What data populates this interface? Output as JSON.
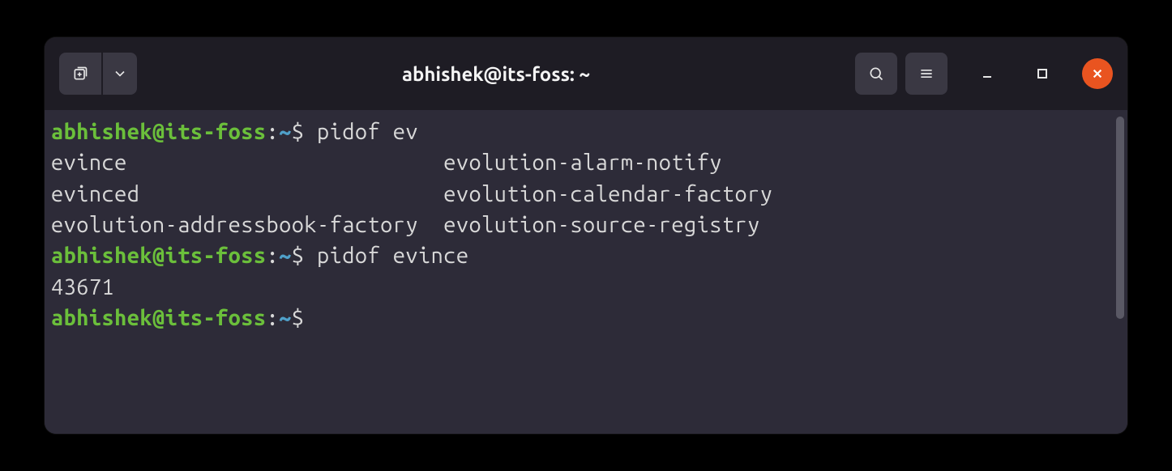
{
  "window": {
    "title": "abhishek@its-foss: ~"
  },
  "prompt": {
    "user_host": "abhishek@its-foss",
    "separator": ":",
    "path": "~",
    "symbol": "$"
  },
  "lines": [
    {
      "type": "prompt",
      "command": "pidof ev"
    },
    {
      "type": "output",
      "text": "evince                         evolution-alarm-notify"
    },
    {
      "type": "output",
      "text": "evinced                        evolution-calendar-factory"
    },
    {
      "type": "output",
      "text": "evolution-addressbook-factory  evolution-source-registry"
    },
    {
      "type": "prompt",
      "command": "pidof evince"
    },
    {
      "type": "output",
      "text": "43671"
    },
    {
      "type": "prompt",
      "command": ""
    }
  ],
  "colors": {
    "window_bg": "#2d2b38",
    "titlebar_bg": "#1e1c24",
    "prompt_user": "#6bbf3b",
    "prompt_path": "#4fa0c9",
    "close_btn": "#e95420",
    "text": "#d8d8d8"
  }
}
